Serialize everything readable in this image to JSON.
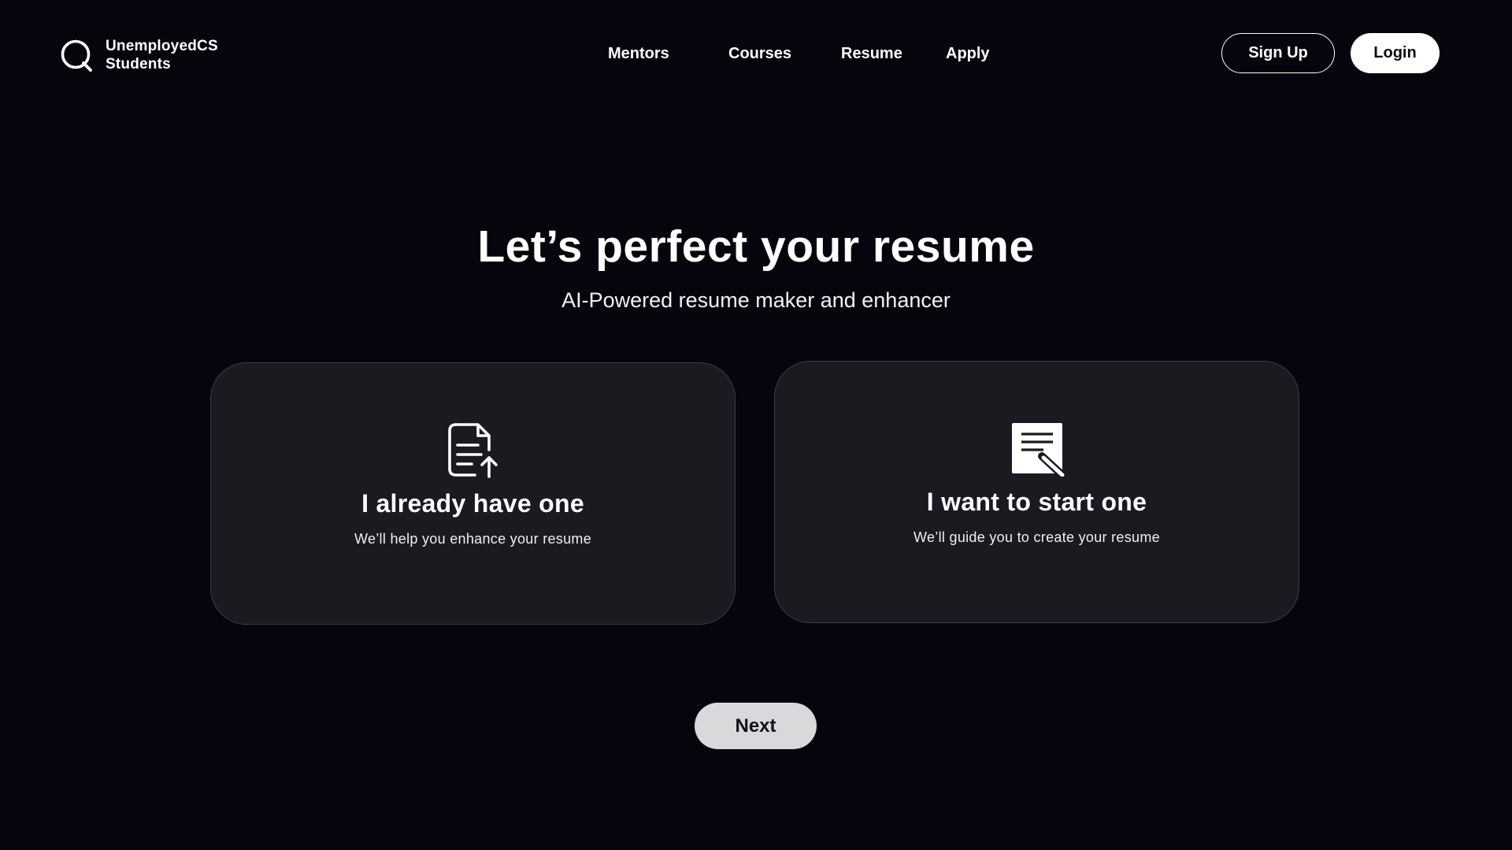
{
  "brand": {
    "line1": "UnemployedCS",
    "line2": "Students",
    "logo_icon": "magnifier-ring-icon"
  },
  "nav": {
    "items": [
      "Mentors",
      "Courses",
      "Resume",
      "Apply"
    ]
  },
  "auth": {
    "signup_label": "Sign Up",
    "login_label": "Login"
  },
  "hero": {
    "title": "Let’s perfect your resume",
    "subtitle": "AI-Powered resume maker and enhancer"
  },
  "options": [
    {
      "title": "I already have one",
      "description": "We’ll help you enhance your resume",
      "icon": "document-upload-icon"
    },
    {
      "title": "I want to start one",
      "description": "We’ll guide you to create your resume",
      "icon": "document-edit-icon"
    }
  ],
  "actions": {
    "next_label": "Next"
  },
  "colors": {
    "background": "#05060d",
    "card": "#1a1a21",
    "card_border": "#3b3b45",
    "primary_text": "#ffffff",
    "next_button": "#d9d9dc"
  }
}
